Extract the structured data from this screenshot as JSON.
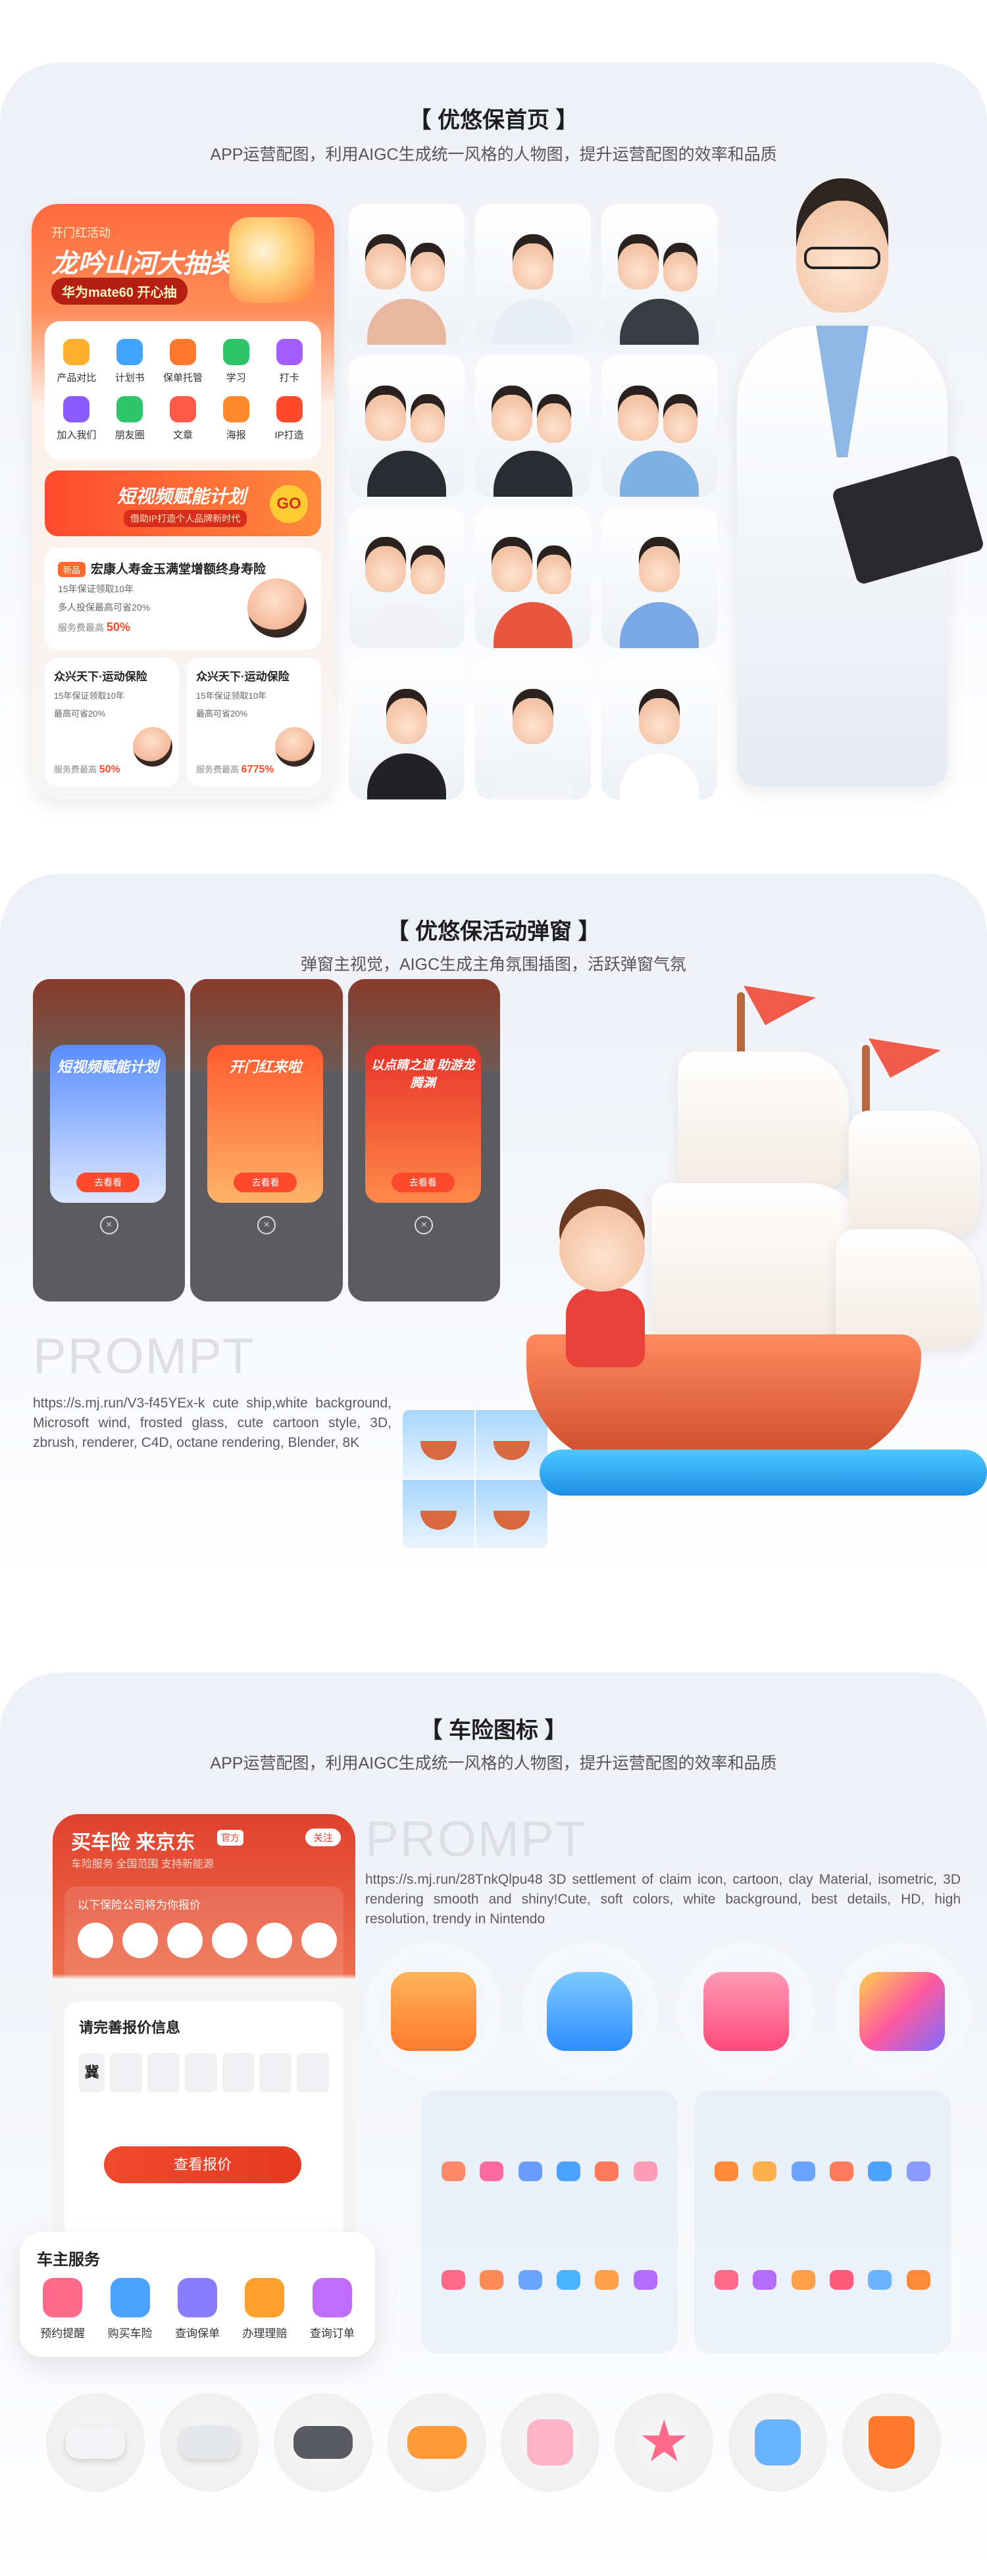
{
  "section1": {
    "title": "【 优悠保首页 】",
    "subtitle": "APP运营配图，利用AIGC生成统一风格的人物图，提升运营配图的效率和品质",
    "phone": {
      "tag": "开门红活动",
      "banner": "龙吟山河大抽奖",
      "pill": "华为mate60 开心抽",
      "grid": [
        {
          "label": "产品对比",
          "color": "#ffb02e"
        },
        {
          "label": "计划书",
          "color": "#3fa4ff"
        },
        {
          "label": "保单托管",
          "color": "#ff7a2e"
        },
        {
          "label": "学习",
          "color": "#2ec46a"
        },
        {
          "label": "打卡",
          "color": "#a35cff"
        },
        {
          "label": "加入我们",
          "color": "#8a5cff"
        },
        {
          "label": "朋友圈",
          "color": "#2ec46a"
        },
        {
          "label": "文章",
          "color": "#ff5a4a"
        },
        {
          "label": "海报",
          "color": "#ff8a2e"
        },
        {
          "label": "IP打造",
          "color": "#ff4a2e"
        }
      ],
      "promo_title": "短视频赋能计划",
      "promo_sub": "借助IP打造个人品牌新时代",
      "promo_go": "GO",
      "product": {
        "badge": "新品",
        "title": "宏康人寿金玉满堂增额终身寿险",
        "line1": "15年保证领取10年",
        "line2": "多人投保最高可省20%",
        "rate_label": "服务费最高",
        "rate": "50%"
      },
      "cards": [
        {
          "title": "众兴天下·运动保险",
          "line1": "15年保证领取10年",
          "line2": "最高可省20%",
          "rate_label": "服务费最高",
          "rate": "50%"
        },
        {
          "title": "众兴天下·运动保险",
          "line1": "15年保证领取10年",
          "line2": "最高可省20%",
          "rate_label": "服务费最高",
          "rate": "6775%"
        }
      ]
    }
  },
  "section2": {
    "title": "【 优悠保活动弹窗 】",
    "subtitle": "弹窗主视觉，AIGC生成主角氛围插图，活跃弹窗气氛",
    "popups": [
      {
        "title": "短视频赋能计划",
        "button": "去看看",
        "color": "#5b8dff"
      },
      {
        "title": "开门红来啦",
        "button": "去看看",
        "color": "#ff5a2e"
      },
      {
        "title": "以点睛之道 助游龙腾渊",
        "button": "去看看",
        "color": "#e8322a"
      }
    ],
    "prompt_title": "PROMPT",
    "prompt_text": "https://s.mj.run/V3-f45YEx-k cute ship,white background, Microsoft wind, frosted glass, cute cartoon style, 3D, zbrush, renderer, C4D, octane rendering, Blender, 8K"
  },
  "section3": {
    "title": "【 车险图标 】",
    "subtitle": "APP运营配图，利用AIGC生成统一风格的人物图，提升运营配图的效率和品质",
    "phone": {
      "title": "买车险 来京东",
      "tag": "官方",
      "follow": "关注",
      "sub": "车险服务 全国范围 支持新能源",
      "card_title": "以下保险公司将为你报价",
      "form_title": "请完善报价信息",
      "plate_prefix": "冀",
      "submit": "查看报价"
    },
    "service": {
      "title": "车主服务",
      "items": [
        {
          "label": "预约提醒",
          "color": "#ff6a8a"
        },
        {
          "label": "购买车险",
          "color": "#4aa4ff"
        },
        {
          "label": "查询保单",
          "color": "#8a7cff"
        },
        {
          "label": "办理理赔",
          "color": "#ffa02e"
        },
        {
          "label": "查询订单",
          "color": "#c06cff"
        }
      ]
    },
    "prompt_title": "PROMPT",
    "prompt_text": "https://s.mj.run/28TnkQlpu48 3D settlement of claim icon, cartoon, clay Material, isometric, 3D rendering smooth and shiny!Cute, soft colors, white background, best details, HD, high resolution, trendy in Nintendo"
  }
}
